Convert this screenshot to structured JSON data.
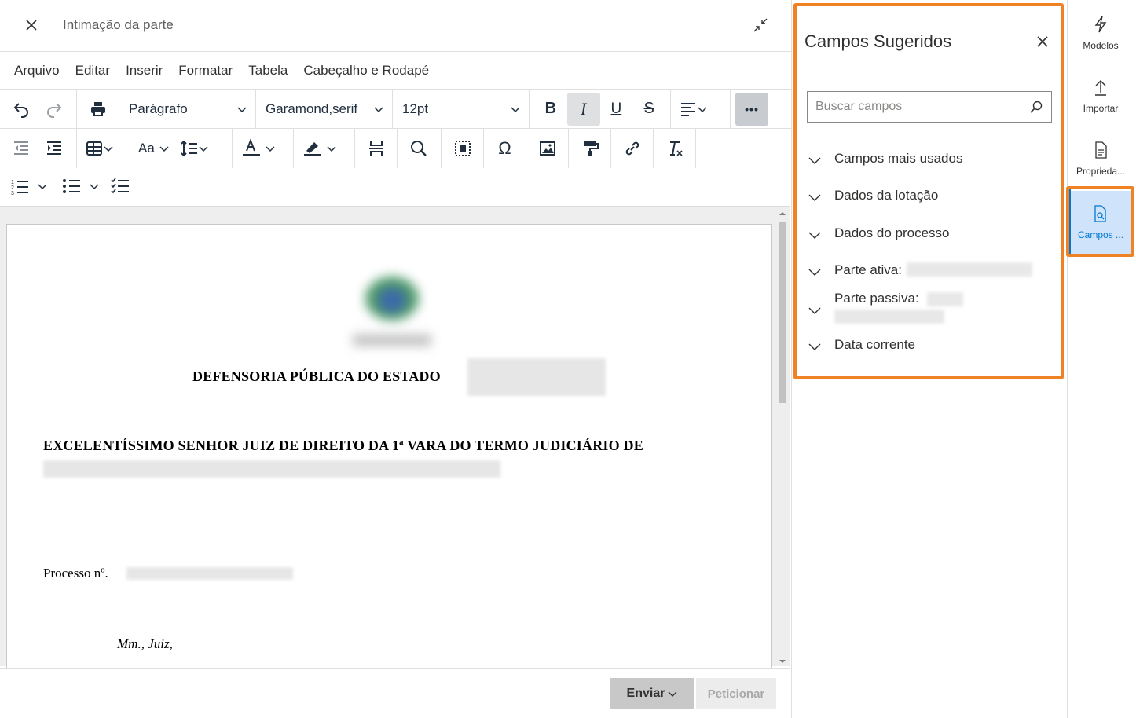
{
  "window": {
    "title": "Intimação da parte"
  },
  "menubar": {
    "items": [
      "Arquivo",
      "Editar",
      "Inserir",
      "Formatar",
      "Tabela",
      "Cabeçalho e Rodapé"
    ]
  },
  "toolbar": {
    "block_format": "Parágrafo",
    "font_family": "Garamond,serif",
    "font_size": "12pt",
    "bold_label": "B",
    "italic_label": "I",
    "underline_label": "U",
    "strike_label": "S",
    "more_label": "•••",
    "case_label": "Aa",
    "special_char_label": "Ω",
    "clear_format_label": "Tx",
    "italic_active": true
  },
  "document": {
    "heading_office": "DEFENSORIA PÚBLICA DO ESTADO",
    "heading_address": "EXCELENTÍSSIMO SENHOR JUIZ DE DIREITO DA 1ª VARA DO TERMO JUDICIÁRIO DE",
    "processo_label": "Processo nº.",
    "saudacao": "Mm., Juiz,"
  },
  "footer": {
    "send_label": "Enviar",
    "petition_label": "Peticionar"
  },
  "panel": {
    "title": "Campos Sugeridos",
    "search_placeholder": "Buscar campos",
    "sections": [
      {
        "label": "Campos mais usados"
      },
      {
        "label": "Dados da lotação"
      },
      {
        "label": "Dados do processo"
      },
      {
        "label": "Parte ativa:"
      },
      {
        "label": "Parte passiva:"
      },
      {
        "label": "Data corrente"
      }
    ]
  },
  "rail": {
    "items": [
      {
        "label": "Modelos",
        "icon": "lightning-icon"
      },
      {
        "label": "Importar",
        "icon": "upload-icon"
      },
      {
        "label": "Proprieda...",
        "icon": "document-properties-icon"
      },
      {
        "label": "Campos ...",
        "icon": "document-search-icon",
        "active": true
      }
    ]
  },
  "colors": {
    "highlight": "#ee8224",
    "accent": "#0078d4",
    "active_rail_bg": "#cfe4fa"
  }
}
